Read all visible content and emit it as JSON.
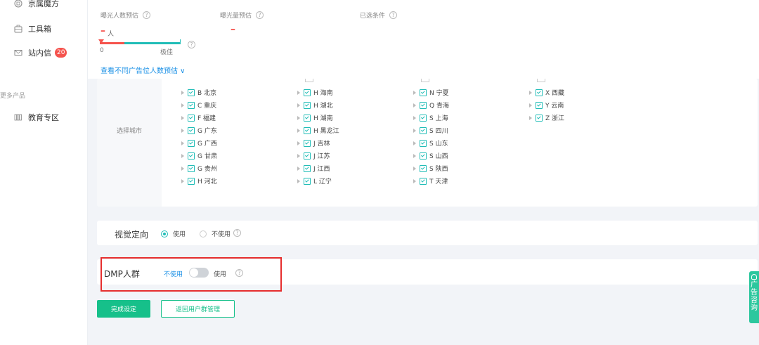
{
  "sidebar": {
    "items": [
      {
        "label": "京属魔方",
        "icon": "cube-icon"
      },
      {
        "label": "工具箱",
        "icon": "toolbox-icon"
      },
      {
        "label": "站内信",
        "icon": "mail-icon",
        "badge": "20"
      },
      {
        "label": "教育专区",
        "icon": "book-icon"
      }
    ],
    "section_label": "更多产品"
  },
  "estimate": {
    "audience_label": "曝光人数预估",
    "audience_value": "–",
    "audience_unit": "人",
    "exposure_label": "曝光量预估",
    "exposure_value": "–",
    "conditions_label": "已选条件",
    "bar_min": "0",
    "bar_max": "极佳",
    "bar_fill_fraction": 0.3,
    "view_link": "查看不同广告位人数预估 ∨"
  },
  "city": {
    "label": "选择城市",
    "col1": [
      "B 北京",
      "C 重庆",
      "F 福建",
      "G 广东",
      "G 广西",
      "G 甘肃",
      "G 贵州",
      "H 河北"
    ],
    "col2": [
      "H 海南",
      "H 湖北",
      "H 湖南",
      "H 黑龙江",
      "J 吉林",
      "J 江苏",
      "J 江西",
      "L 辽宁"
    ],
    "col3": [
      "N 宁夏",
      "Q 青海",
      "S 上海",
      "S 四川",
      "S 山东",
      "S 山西",
      "S 陕西",
      "T 天津"
    ],
    "col4": [
      "X 西藏",
      "Y 云南",
      "Z 浙江"
    ]
  },
  "vision": {
    "title": "视觉定向",
    "use_label": "使用",
    "not_use_label": "不使用"
  },
  "dmp": {
    "title": "DMP人群",
    "off_label": "不使用",
    "on_label": "使用"
  },
  "buttons": {
    "finish": "完成设定",
    "back": "返回用户群管理"
  },
  "float": {
    "chars": [
      "广",
      "告",
      "咨",
      "询"
    ]
  },
  "colors": {
    "accent": "#21bdb7",
    "primary_button": "#16c08a",
    "link": "#1a90e6",
    "alert": "#f5534d",
    "highlight_box": "#e62e2e"
  }
}
